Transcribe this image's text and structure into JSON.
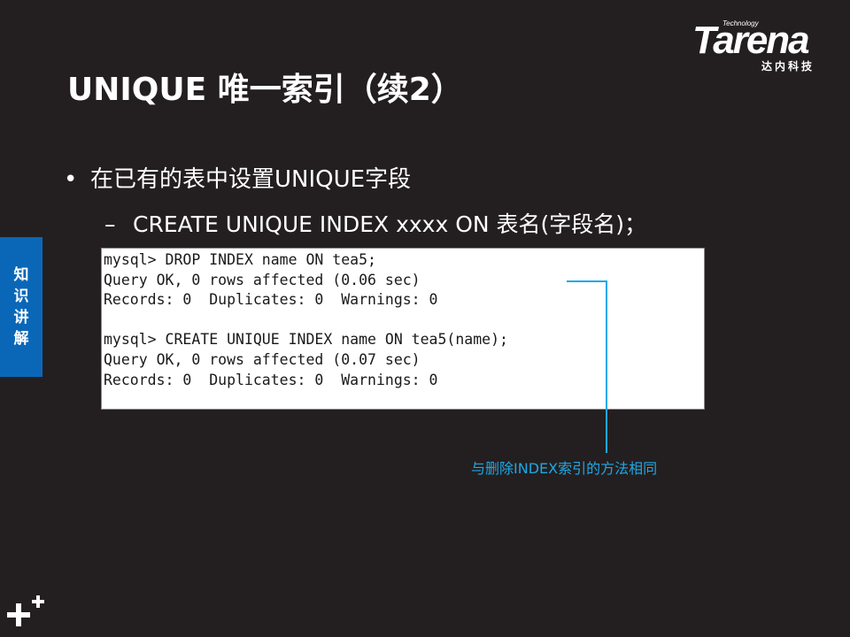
{
  "logo": {
    "technology": "Technology",
    "brand": "Tarena",
    "chinese": "达内科技"
  },
  "slide": {
    "title": "UNIQUE 唯一索引（续2）",
    "bullet": "在已有的表中设置UNIQUE字段",
    "bullet_marker": "•",
    "sub_bullet": "CREATE UNIQUE INDEX xxxx ON 表名(字段名)；",
    "sub_marker": "–"
  },
  "side_tab": {
    "chars": [
      "知",
      "识",
      "讲",
      "解"
    ]
  },
  "code_lines": [
    "mysql> DROP INDEX name ON tea5;",
    "Query OK, 0 rows affected (0.06 sec)",
    "Records: 0  Duplicates: 0  Warnings: 0",
    "",
    "mysql> CREATE UNIQUE INDEX name ON tea5(name);",
    "Query OK, 0 rows affected (0.07 sec)",
    "Records: 0  Duplicates: 0  Warnings: 0"
  ],
  "annotation": "与删除INDEX索引的方法相同",
  "colors": {
    "background": "#231f20",
    "side_tab": "#0a67b8",
    "annotation": "#1ea8e6"
  },
  "icons": {
    "corner_mark": "plus-icon"
  }
}
